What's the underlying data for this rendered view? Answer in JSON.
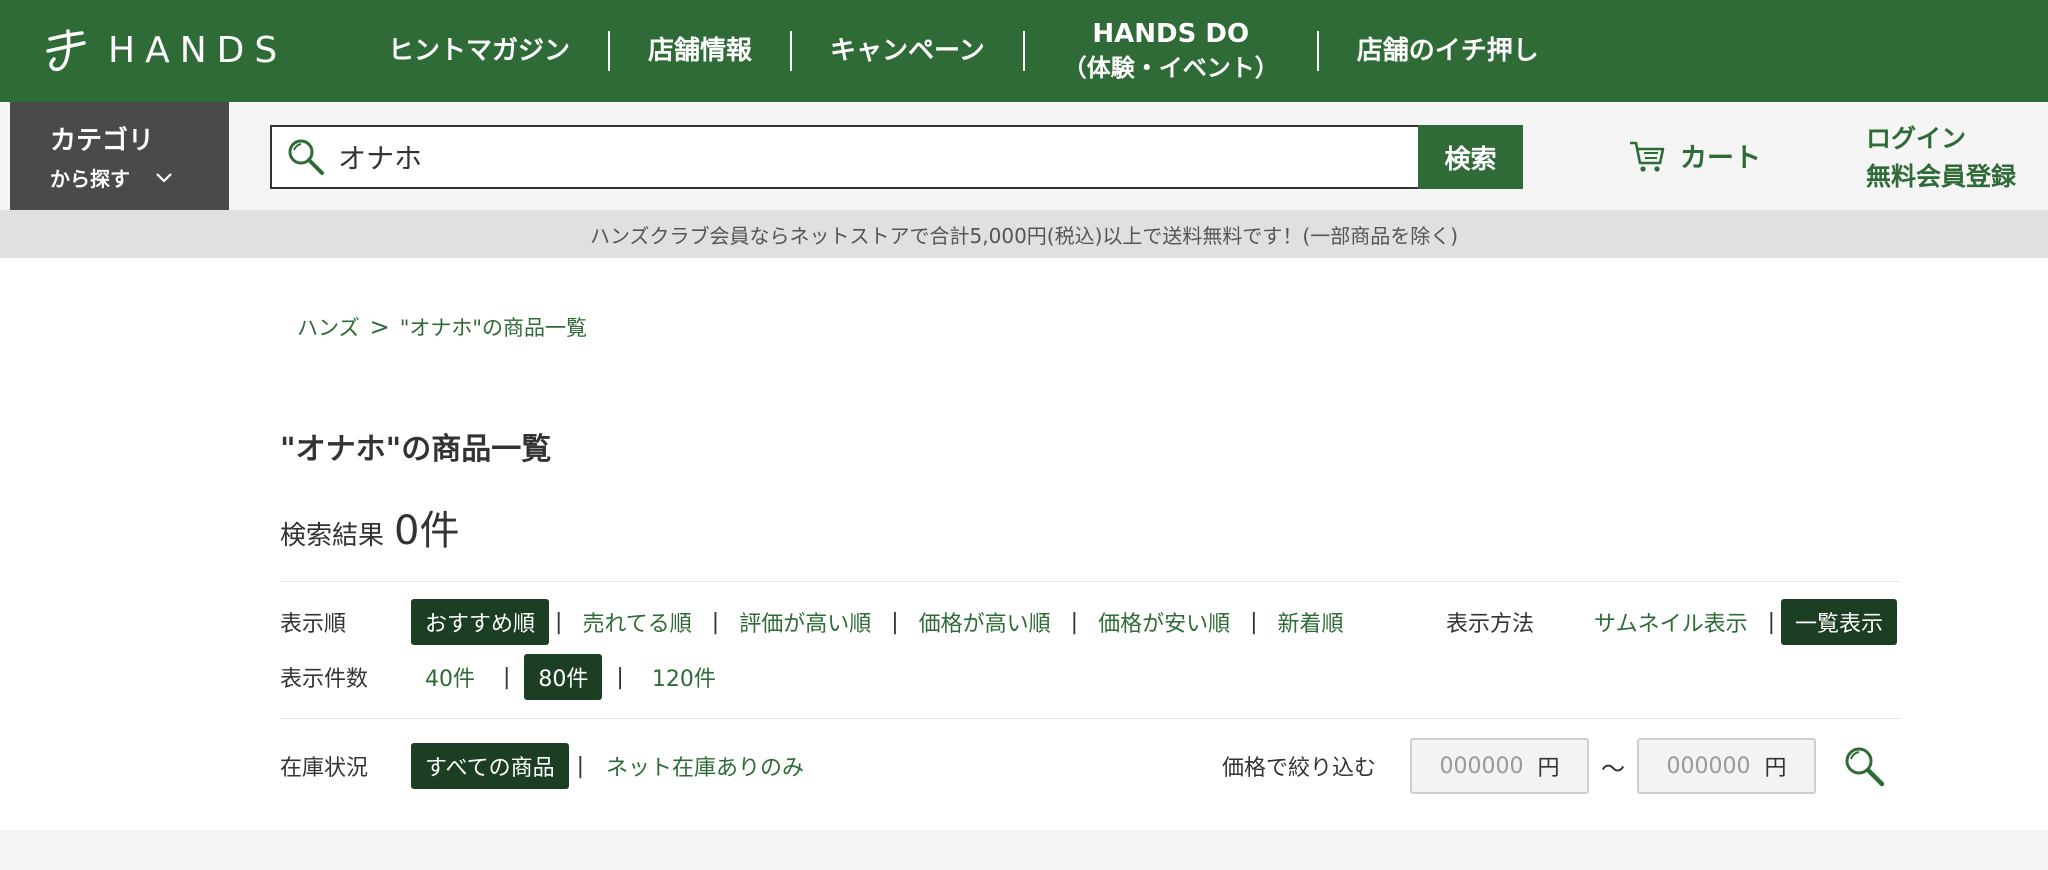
{
  "header": {
    "brand": "HANDS",
    "nav": [
      {
        "label": "ヒントマガジン"
      },
      {
        "label": "店舗情報"
      },
      {
        "label": "キャンペーン"
      },
      {
        "label": "HANDS DO",
        "sub": "（体験・イベント）"
      },
      {
        "label": "店舗のイチ押し"
      }
    ]
  },
  "search": {
    "category_line1": "カテゴリ",
    "category_line2": "から探す",
    "query": "オナホ",
    "button": "検索",
    "cart": "カート",
    "login": "ログイン",
    "register": "無料会員登録"
  },
  "notice": "ハンズクラブ会員ならネットストアで合計5,000円(税込)以上で送料無料です！(一部商品を除く)",
  "breadcrumb": {
    "home": "ハンズ",
    "separator": ">",
    "current": "\"オナホ\"の商品一覧"
  },
  "page": {
    "title": "\"オナホ\"の商品一覧",
    "result_label": "検索結果",
    "result_count": "0件"
  },
  "sort": {
    "label": "表示順",
    "options": [
      "おすすめ順",
      "売れてる順",
      "評価が高い順",
      "価格が高い順",
      "価格が安い順",
      "新着順"
    ],
    "active": 0
  },
  "view": {
    "label": "表示方法",
    "options": [
      "サムネイル表示",
      "一覧表示"
    ],
    "active": 1
  },
  "per_page": {
    "label": "表示件数",
    "options": [
      "40件",
      "80件",
      "120件"
    ],
    "active": 1
  },
  "stock": {
    "label": "在庫状況",
    "options": [
      "すべての商品",
      "ネット在庫ありのみ"
    ],
    "active": 0
  },
  "price_filter": {
    "label": "価格で絞り込む",
    "min_placeholder": "000000",
    "max_placeholder": "000000",
    "unit": "円",
    "range_sep": "〜"
  },
  "colors": {
    "brand_green": "#2e6b36",
    "active_dark": "#1c3f24"
  }
}
